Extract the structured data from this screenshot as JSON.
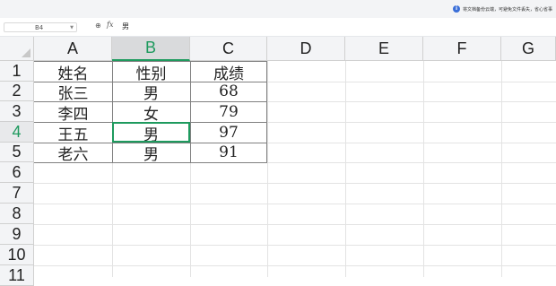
{
  "notice": {
    "icon": "info-icon",
    "text": "将文档备份云端，可避免文件丢失，省心省事"
  },
  "formula_bar": {
    "cell_ref": "B4",
    "fx": "fx",
    "value": "男"
  },
  "columns": [
    "A",
    "B",
    "C",
    "D",
    "E",
    "F",
    "G"
  ],
  "rows": [
    "1",
    "2",
    "3",
    "4",
    "5",
    "6",
    "7",
    "8",
    "9",
    "10",
    "11"
  ],
  "active_cell": {
    "col": "B",
    "row": "4"
  },
  "table": {
    "headers": [
      "姓名",
      "性别",
      "成绩"
    ],
    "rows": [
      [
        "张三",
        "男",
        "68"
      ],
      [
        "李四",
        "女",
        "79"
      ],
      [
        "王五",
        "男",
        "97"
      ],
      [
        "老六",
        "男",
        "91"
      ]
    ]
  },
  "colors": {
    "accent": "#1e9a5e",
    "header_bg": "#f3f4f6",
    "info_icon": "#3b6fd8"
  }
}
